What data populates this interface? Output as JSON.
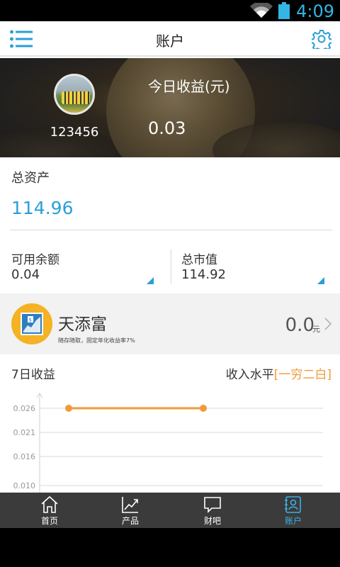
{
  "status_bar": {
    "time": "4:09",
    "accent": "#33b5e5"
  },
  "header": {
    "title": "账户",
    "menu_icon": "menu-icon",
    "settings_icon": "gear-icon"
  },
  "profile": {
    "username": "123456",
    "today_earnings_label": "今日收益(元)",
    "today_earnings_value": "0.03"
  },
  "assets": {
    "total_label": "总资产",
    "total_value": "114.96",
    "available_label": "可用余额",
    "available_value": "0.04",
    "market_label": "总市值",
    "market_value": "114.92"
  },
  "product": {
    "name": "天添富",
    "desc": "随存随取，固定年化收益率7%",
    "amount": "0.0",
    "unit": "元"
  },
  "chart_section": {
    "title": "7日收益",
    "level_prefix": "收入水平",
    "level_value": "[一穷二白]"
  },
  "chart_data": {
    "type": "line",
    "y_ticks": [
      "0.026",
      "0.021",
      "0.016",
      "0.010"
    ],
    "ylim": [
      0.01,
      0.026
    ],
    "series": [
      {
        "values": [
          0.026,
          0.026
        ]
      }
    ],
    "grid": true,
    "line_color": "#f29a3a"
  },
  "tabs": [
    {
      "label": "首页",
      "icon": "home-icon",
      "active": false
    },
    {
      "label": "产品",
      "icon": "trend-icon",
      "active": false
    },
    {
      "label": "财吧",
      "icon": "chat-icon",
      "active": false
    },
    {
      "label": "账户",
      "icon": "account-icon",
      "active": true
    }
  ],
  "colors": {
    "accent": "#2a9fd6",
    "highlight": "#f29a3a",
    "tabbar": "#3b3b3b"
  }
}
